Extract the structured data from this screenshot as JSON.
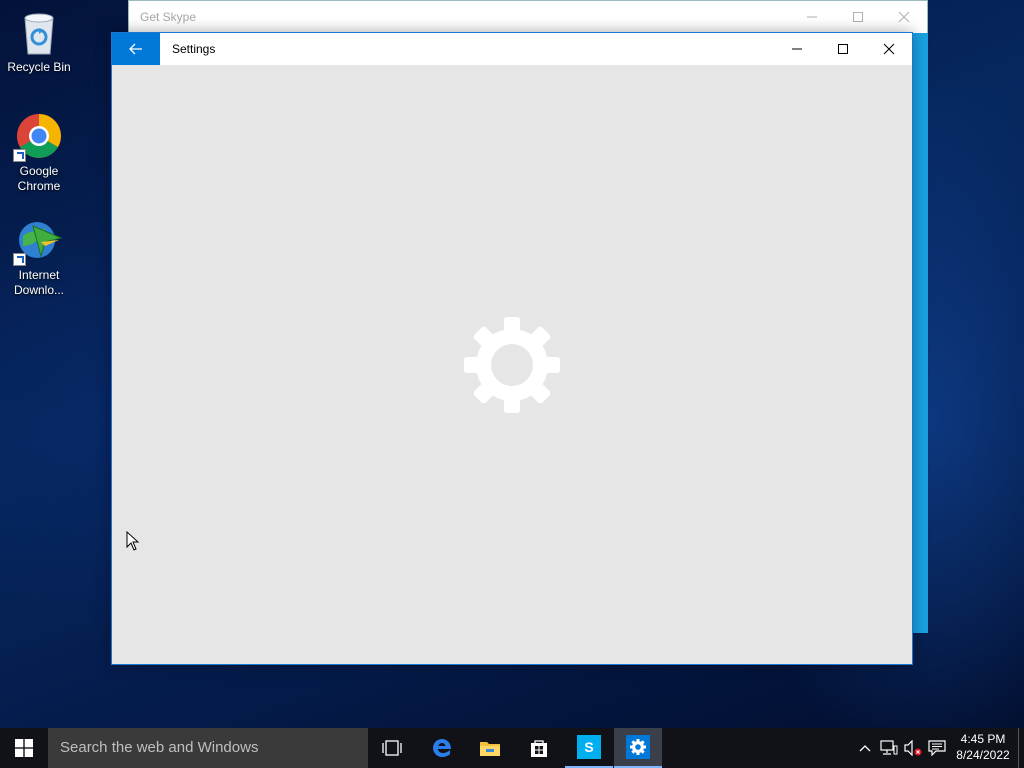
{
  "desktop": {
    "icons": [
      {
        "label": "Recycle Bin",
        "icon": "recycle-bin-icon"
      },
      {
        "label": "Google Chrome",
        "icon": "chrome-icon"
      },
      {
        "label": "Internet Downlo...",
        "icon": "internet-download-manager-icon"
      }
    ]
  },
  "background_window": {
    "title": "Get Skype",
    "accent": "#1ba1e2"
  },
  "settings_window": {
    "title": "Settings",
    "back_icon": "back-arrow-icon",
    "loading_icon": "gear-icon",
    "accent": "#0078d7"
  },
  "taskbar": {
    "search_placeholder": "Search the web and Windows",
    "apps": [
      "task-view-icon",
      "edge-icon",
      "file-explorer-icon",
      "store-icon",
      "skype-icon",
      "settings-icon"
    ],
    "clock": {
      "time": "4:45 PM",
      "date": "8/24/2022"
    }
  }
}
